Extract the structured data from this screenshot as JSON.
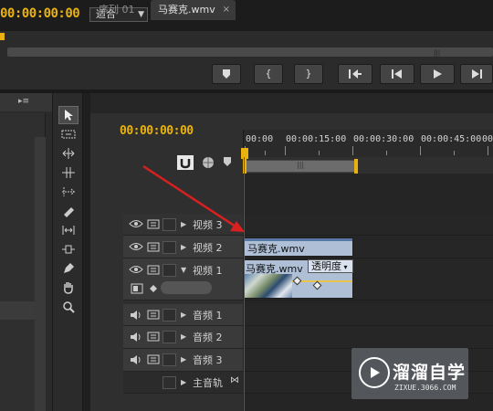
{
  "monitor": {
    "timecode": "00:00:00:00",
    "fit_label": "适合"
  },
  "timeline": {
    "tab_sequence": "序列 01",
    "tab_active": "马赛克.wmv",
    "tab_close": "×",
    "timecode": "00:00:00:00",
    "ruler_labels": [
      "00:00",
      "00:00:15:00",
      "00:00:30:00",
      "00:00:45:00",
      "00"
    ],
    "tracks": {
      "video3": "视频 3",
      "video2": "视频 2",
      "video1": "视频 1",
      "audio1": "音频 1",
      "audio2": "音频 2",
      "audio3": "音频 3",
      "master": "主音轨"
    },
    "clip_v2_name": "马赛克.wmv",
    "clip_v1_name": "马赛克.wmv",
    "opacity_label": "透明度"
  },
  "watermark": {
    "text": "溜溜自学",
    "url": "ZIXUE.3066.COM"
  },
  "colors": {
    "timecode": "#e9b20f",
    "clip": "#aebfd6",
    "playhead": "#d92020"
  }
}
